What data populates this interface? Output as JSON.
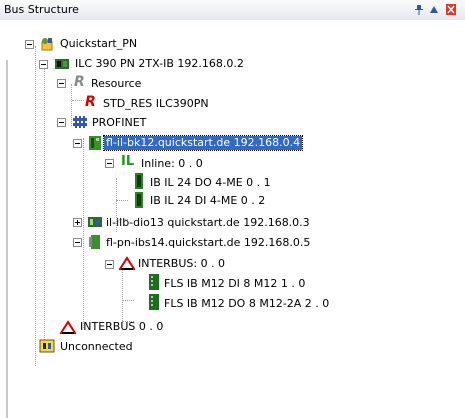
{
  "window": {
    "title": "Bus Structure"
  },
  "tree": {
    "root": "Quickstart_PN",
    "controller": "ILC 390 PN 2TX-IB 192.168.0.2",
    "resource": "Resource",
    "std_res": "STD_RES ILC390PN",
    "profinet": "PROFINET",
    "bk12": "fl-il-bk12.quickstart.de 192.168.0.4",
    "inline": "Inline: 0 . 0",
    "do": "IB IL 24 DO 4-ME 0 . 1",
    "di": "IB IL 24 DI 4-ME 0 . 2",
    "dio13": "il-ilb-dio13 quickstart.de 192.168.0.3",
    "ibs14": "fl-pn-ibs14.quickstart.de 192.168.0.5",
    "interbus_sub": "INTERBUS: 0 . 0",
    "fls1": "FLS IB M12 DI 8 M12 1 . 0",
    "fls2": "FLS IB M12 DO 8 M12-2A 2 . 0",
    "interbus_main": "INTERBUS 0 . 0",
    "unconnected": "Unconnected"
  },
  "colors": {
    "selection": "#316ac5",
    "title_bar": "#e6e8ee"
  },
  "icons": {
    "pin": "pin-icon",
    "up": "arrow-up-icon",
    "close": "close-icon"
  }
}
